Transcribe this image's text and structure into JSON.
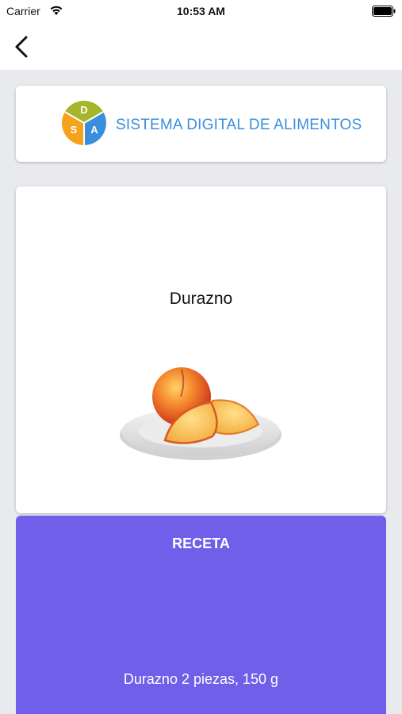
{
  "status_bar": {
    "carrier": "Carrier",
    "time": "10:53 AM"
  },
  "nav": {
    "back_icon": "chevron-left-icon"
  },
  "logo": {
    "letters": [
      "D",
      "S",
      "A"
    ],
    "text": "SISTEMA DIGITAL DE ALIMENTOS",
    "colors": {
      "top": "#a6b52a",
      "left": "#f5a21c",
      "right": "#3a8fdc",
      "text": "#3a8fdc"
    }
  },
  "food": {
    "name": "Durazno",
    "image_icon": "peach-plate-image"
  },
  "recipe": {
    "title": "RECETA",
    "ingredient": "Durazno 2 piezas, 150 g",
    "accent_color": "#6f5fe9"
  }
}
